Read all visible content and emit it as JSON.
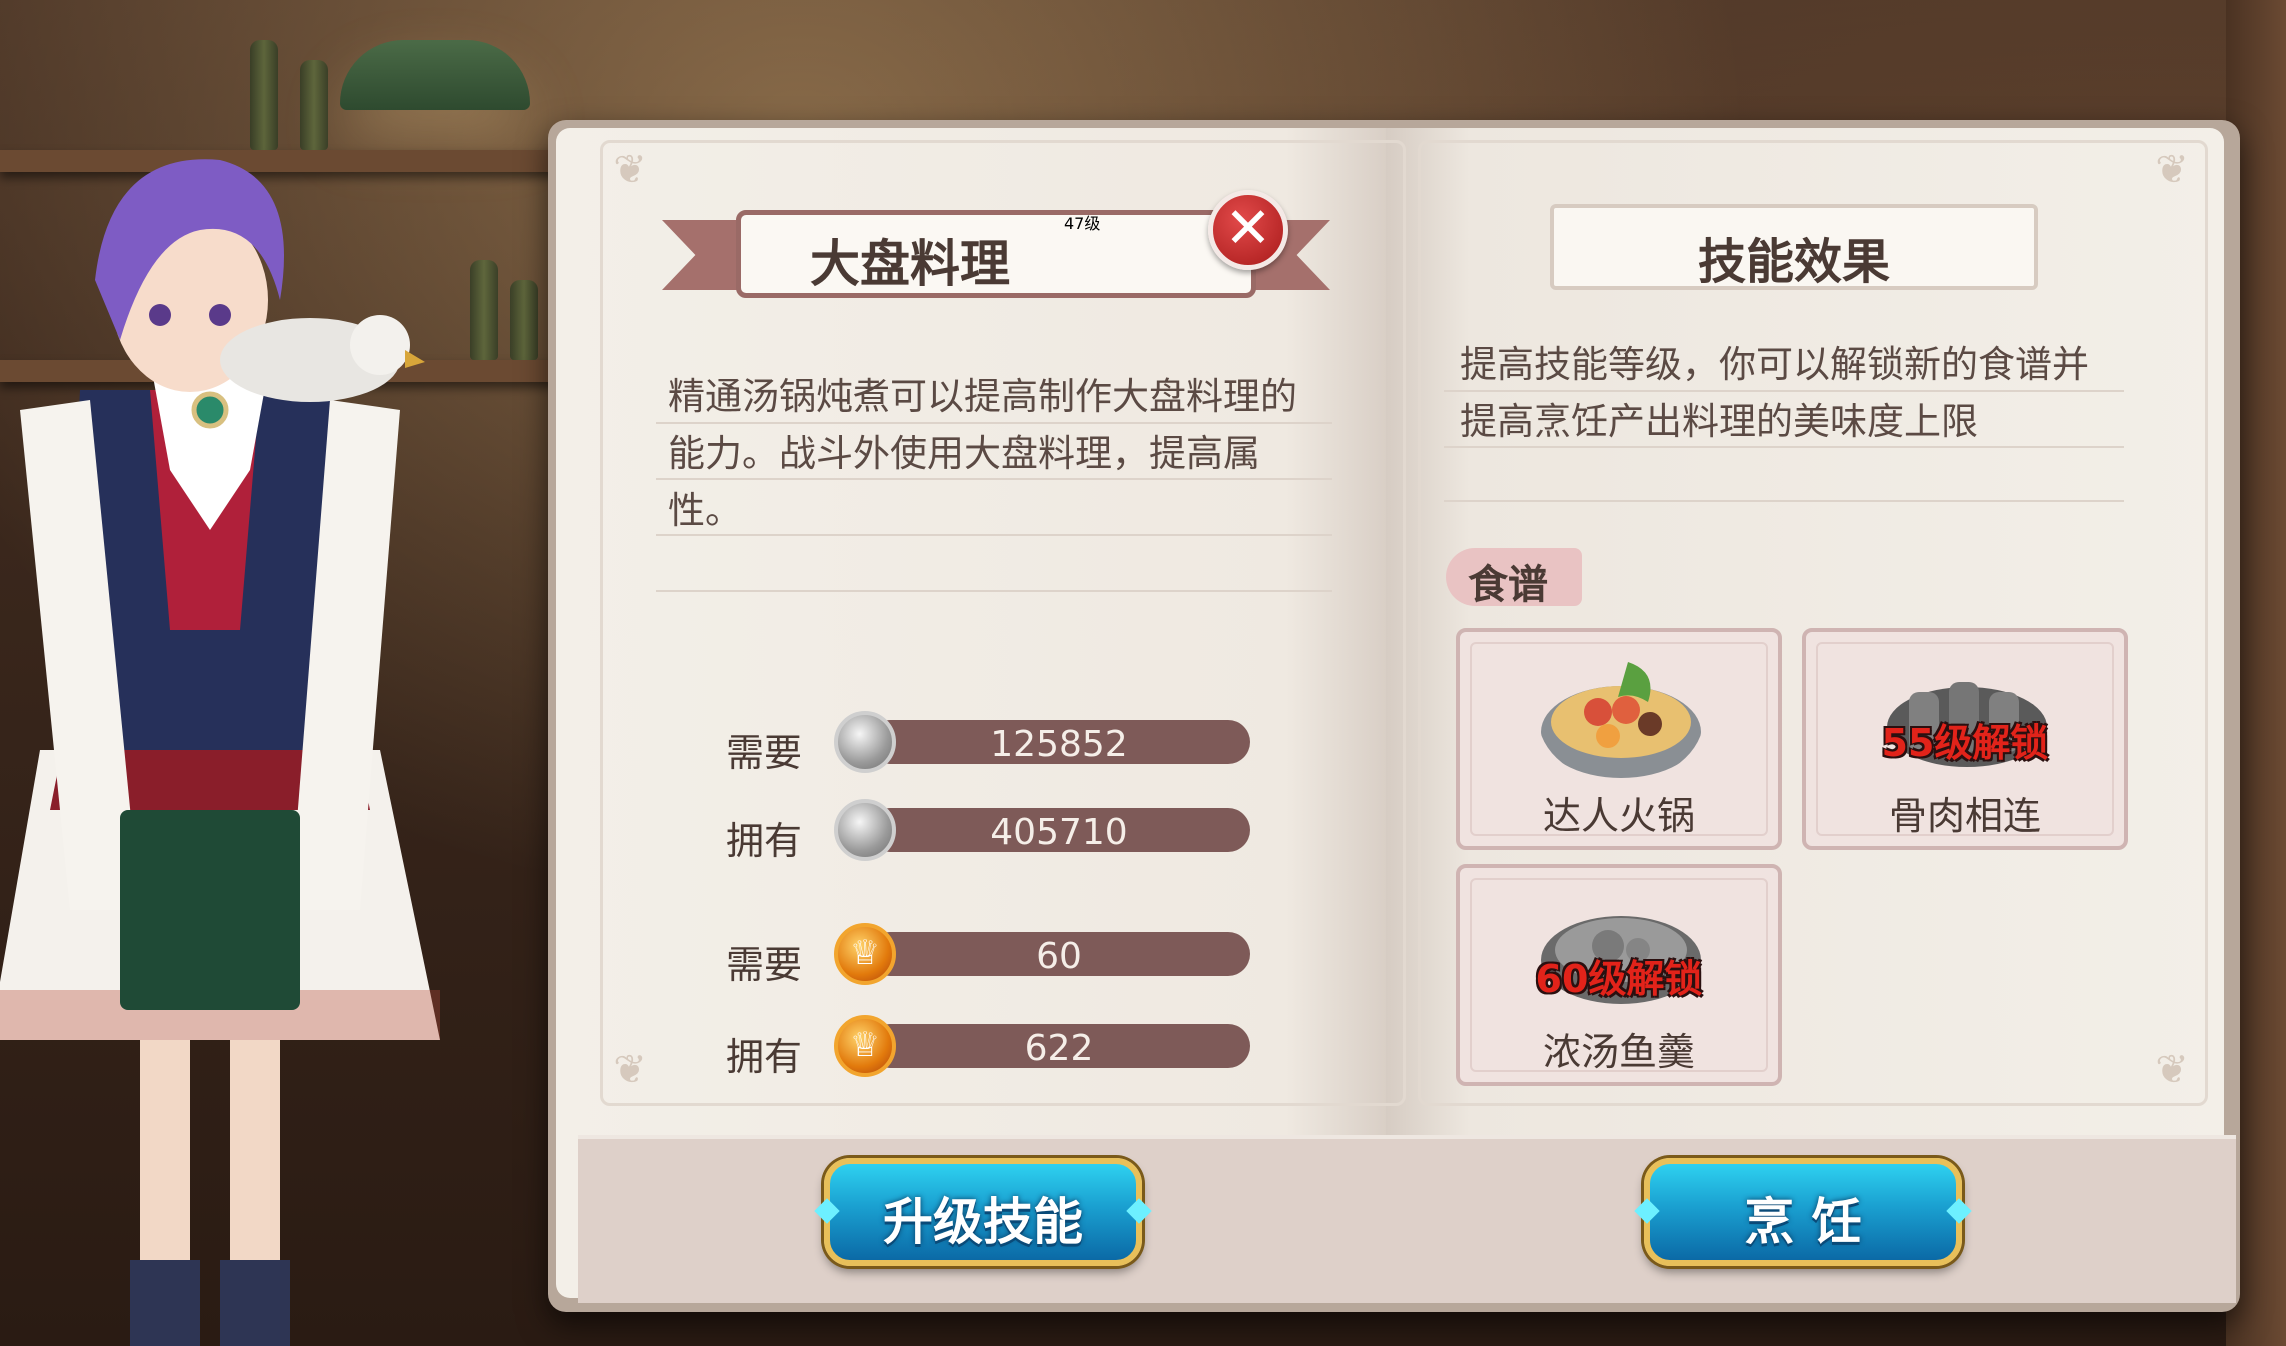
{
  "skill": {
    "name": "大盘料理",
    "level": "47级",
    "description": "精通汤锅炖煮可以提高制作大盘料理的能力。战斗外使用大盘料理，提高属性。"
  },
  "costs": [
    {
      "label": "需要",
      "icon": "silver-coin-icon",
      "value": "125852"
    },
    {
      "label": "拥有",
      "icon": "silver-coin-icon",
      "value": "405710"
    },
    {
      "label": "需要",
      "icon": "trophy-icon",
      "value": "60"
    },
    {
      "label": "拥有",
      "icon": "trophy-icon",
      "value": "622"
    }
  ],
  "effect": {
    "title": "技能效果",
    "text": "提高技能等级，你可以解锁新的食谱并提高烹饪产出料理的美味度上限"
  },
  "recipes_tag": "食谱",
  "recipes": [
    {
      "name": "达人火锅",
      "lock_text": ""
    },
    {
      "name": "骨肉相连",
      "lock_text": "55级解锁"
    },
    {
      "name": "浓汤鱼羹",
      "lock_text": "60级解锁"
    }
  ],
  "buttons": {
    "upgrade": "升级技能",
    "cook": "烹 饪"
  },
  "close_icon": "close-icon",
  "colors": {
    "level": "#f0c020",
    "lock": "#e2231a",
    "button": "#1a9fd0"
  }
}
